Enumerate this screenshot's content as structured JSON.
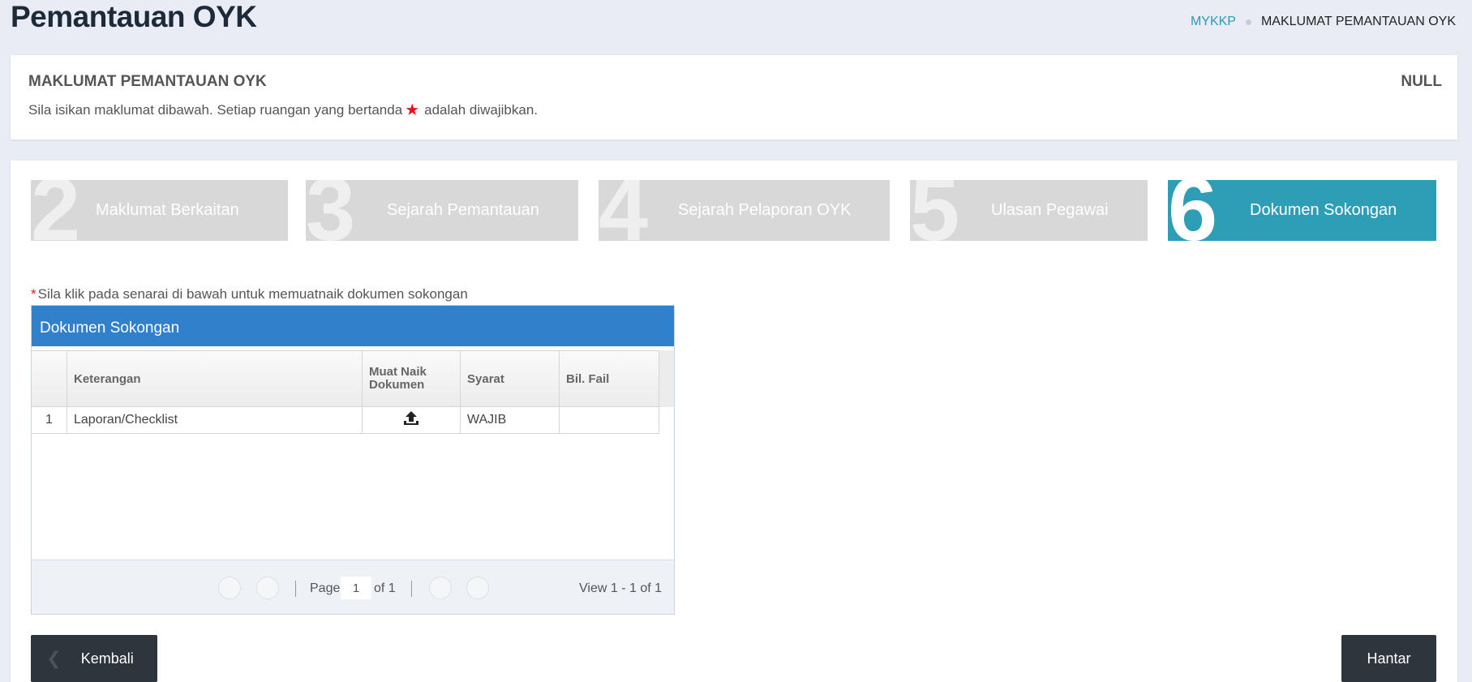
{
  "header": {
    "title": "Pemantauan OYK",
    "breadcrumb": [
      "MYKKP",
      "MAKLUMAT PEMANTAUAN OYK"
    ]
  },
  "info": {
    "heading": "MAKLUMAT PEMANTAUAN OYK",
    "status": "NULL",
    "instruction_before": "Sila isikan maklumat dibawah. Setiap ruangan yang bertanda",
    "instruction_after": "adalah diwajibkan."
  },
  "steps": [
    {
      "num": "2",
      "label": "Maklumat Berkaitan",
      "active": false
    },
    {
      "num": "3",
      "label": "Sejarah Pemantauan",
      "active": false
    },
    {
      "num": "4",
      "label": "Sejarah Pelaporan OYK",
      "active": false
    },
    {
      "num": "5",
      "label": "Ulasan Pegawai",
      "active": false
    },
    {
      "num": "6",
      "label": "Dokumen Sokongan",
      "active": true
    }
  ],
  "upload_note": {
    "marker": "*",
    "text": "Sila klik pada senarai di bawah untuk memuatnaik dokumen sokongan"
  },
  "grid": {
    "caption": "Dokumen Sokongan",
    "columns": [
      "",
      "Keterangan",
      "Muat Naik Dokumen",
      "Syarat",
      "Bil. Fail"
    ],
    "rows": [
      {
        "no": "1",
        "keterangan": "Laporan/Checklist",
        "upload_icon": "upload-icon",
        "syarat": "WAJIB",
        "bil_fail": ""
      }
    ],
    "pager": {
      "page_label": "Page",
      "page_value": "1",
      "of_label": "of 1",
      "view_text": "View 1 - 1 of 1"
    }
  },
  "actions": {
    "back_label": "Kembali",
    "submit_label": "Hantar"
  },
  "colors": {
    "accent": "#2d9eb5",
    "grid_caption": "#3080cc",
    "required": "#e8161b",
    "dark_button": "#2f353d"
  }
}
